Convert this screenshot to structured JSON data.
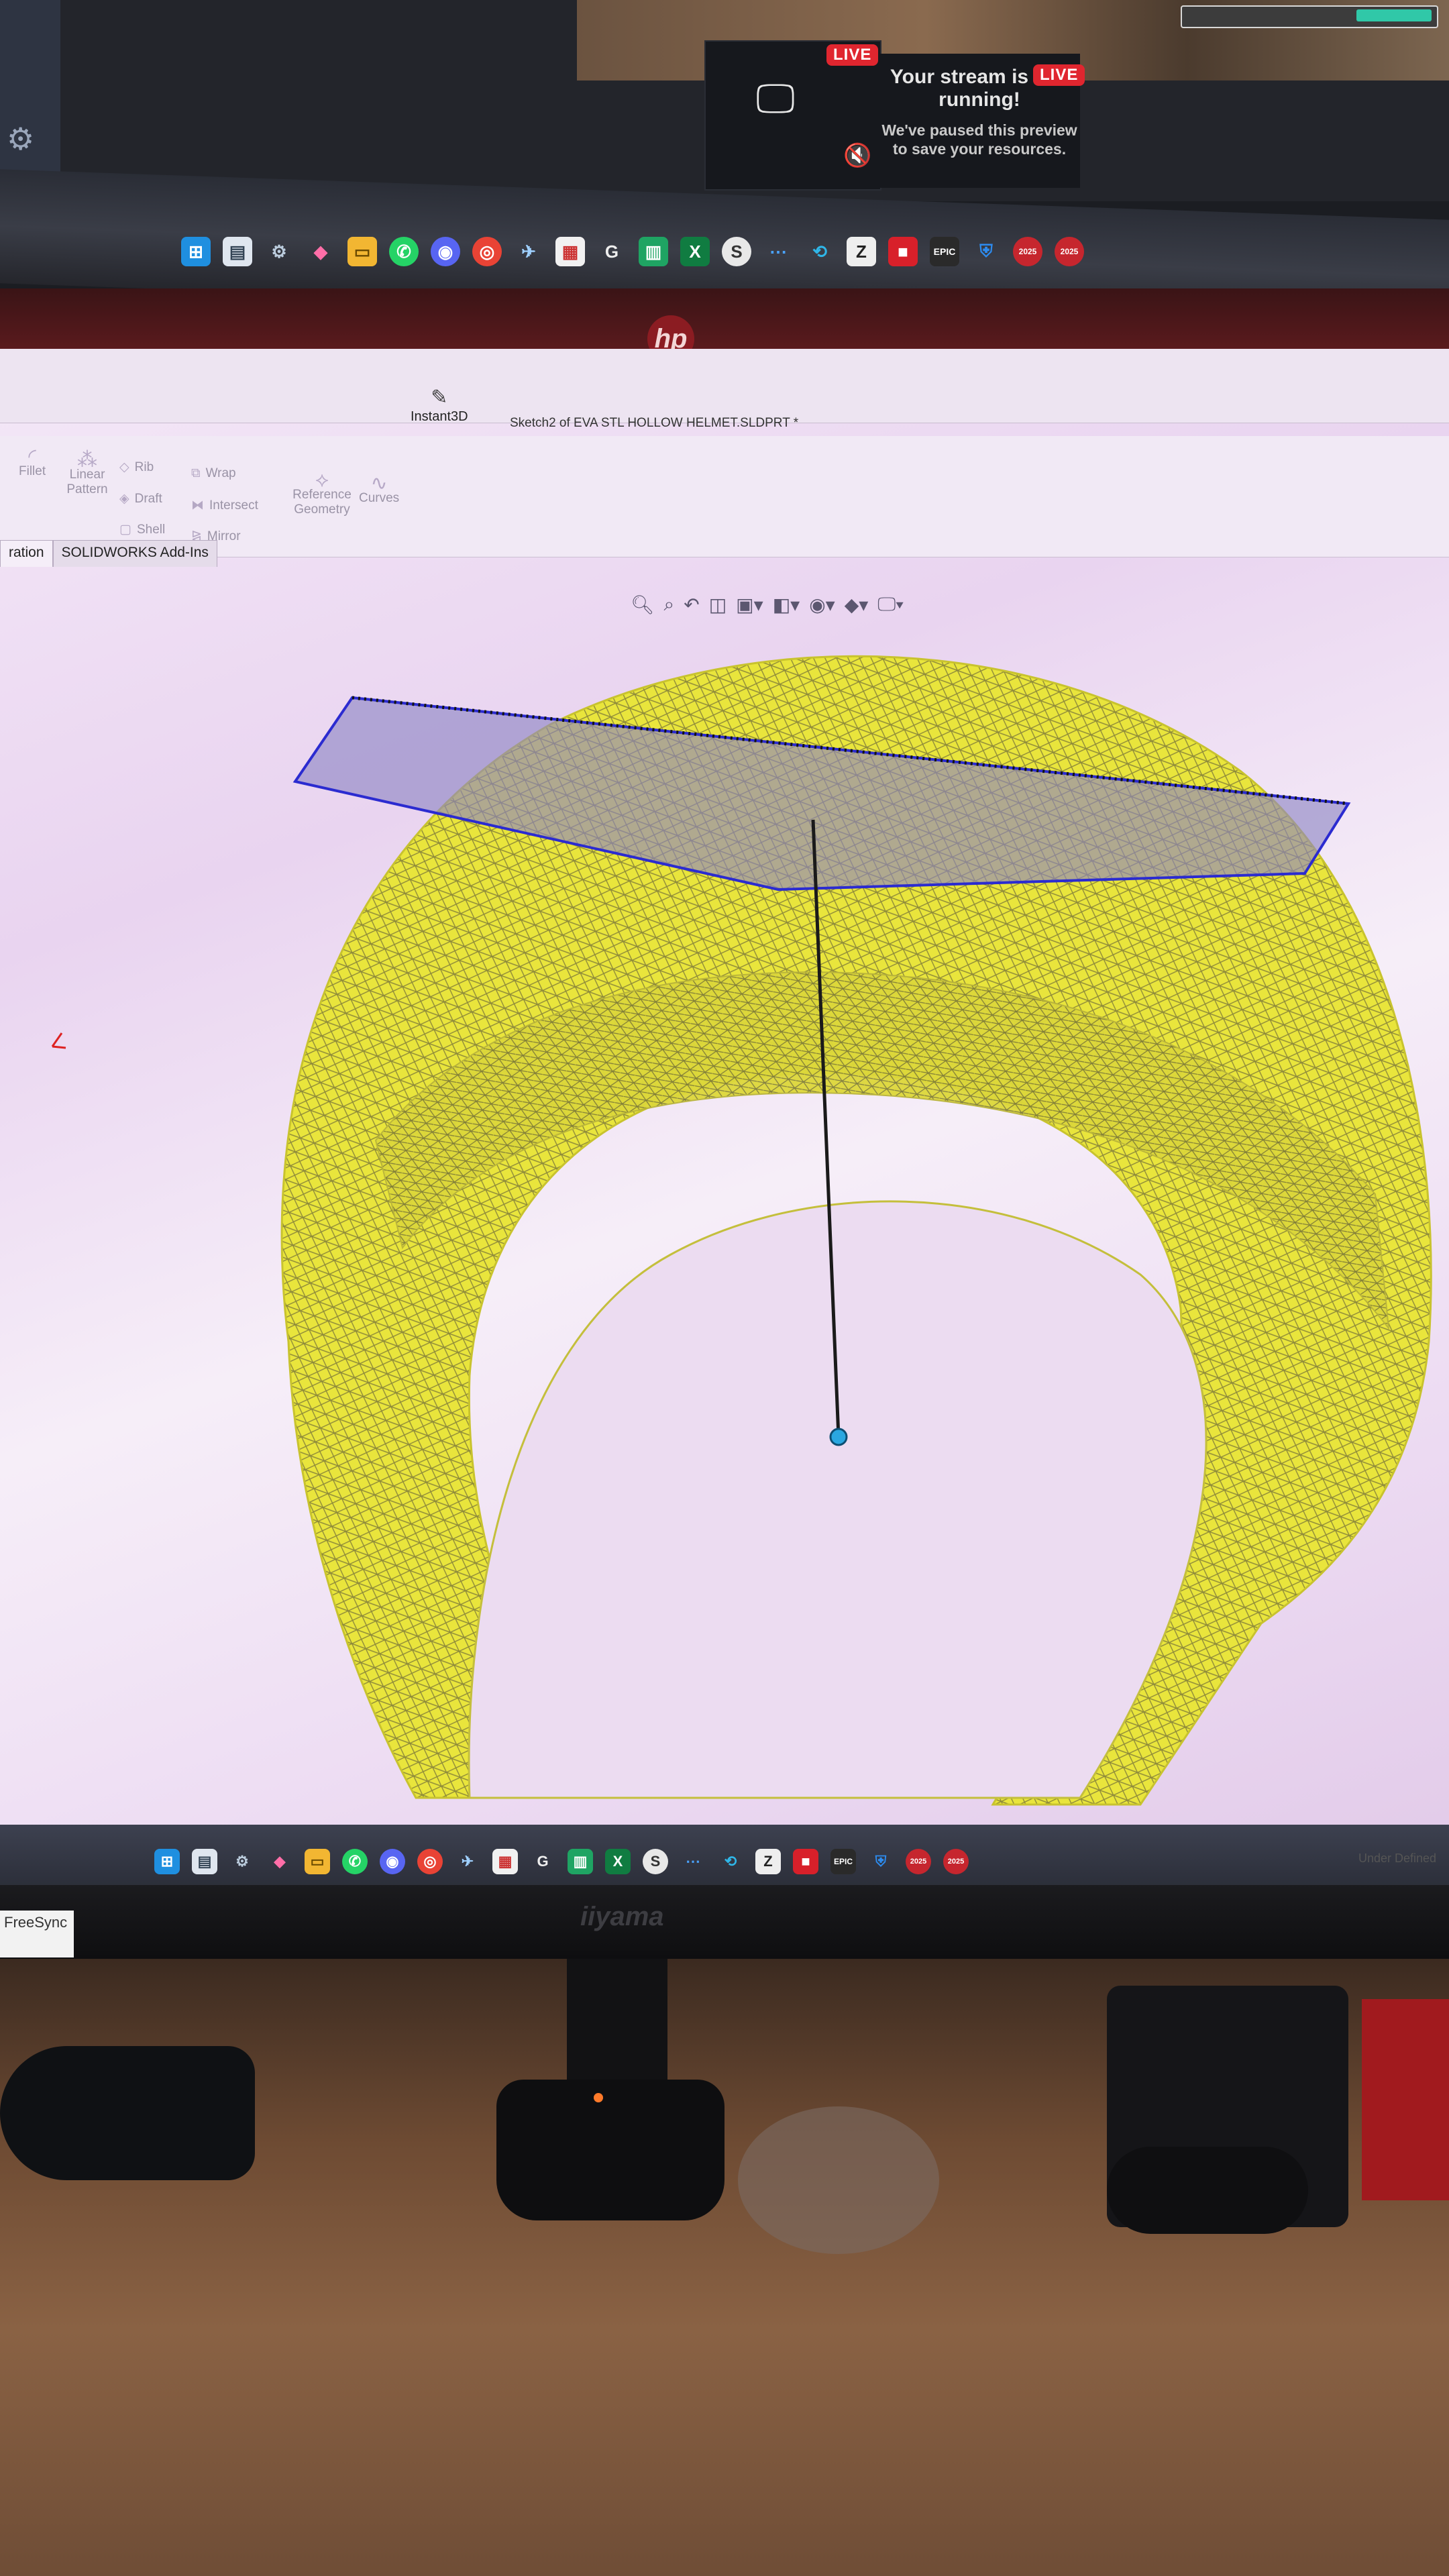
{
  "top_monitor": {
    "live_badge_1": "LIVE",
    "live_badge_2": "LIVE",
    "stream_title": "Your stream is still running!",
    "stream_subtitle": "We've paused this preview to save your resources.",
    "taskbar_icons": [
      "windows-start",
      "notepad",
      "settings",
      "paint",
      "file-explorer",
      "whatsapp",
      "discord",
      "chrome",
      "steam",
      "sticky-notes",
      "g-hub",
      "sheets",
      "excel",
      "app-s",
      "dots",
      "vpn",
      "launcher",
      "roblox",
      "epic",
      "shield",
      "calendar-2025",
      "calendar-2025"
    ]
  },
  "brand": {
    "hp": "hp",
    "monitor": "iiyama",
    "freesync": "FreeSync"
  },
  "solidworks": {
    "document_title": "Sketch2 of EVA STL HOLLOW HELMET.SLDPRT *",
    "ribbon": {
      "fillet": "Fillet",
      "linear_pattern": "Linear Pattern",
      "rib": "Rib",
      "draft": "Draft",
      "shell": "Shell",
      "wrap": "Wrap",
      "intersect": "Intersect",
      "mirror": "Mirror",
      "reference_geometry": "Reference Geometry",
      "curves": "Curves",
      "instant3d": "Instant3D"
    },
    "tabs": [
      "ration",
      "SOLIDWORKS Add-Ins"
    ],
    "status": "Under Defined",
    "colors": {
      "mesh": "#e8e43a",
      "sketch_plane": "#8d84c4",
      "sketch_line": "#1a1a1a",
      "background": "#f1e6f6"
    }
  }
}
